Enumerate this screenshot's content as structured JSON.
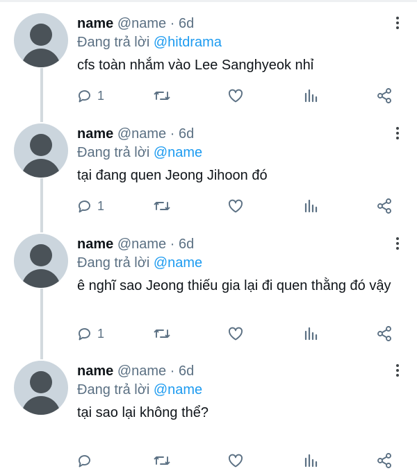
{
  "colors": {
    "link": "#1d9bf0",
    "secondary": "#5b7083",
    "text": "#0f1419",
    "avatar_bg": "#cbd5dd",
    "thread_line": "#d3dade"
  },
  "icons": [
    "more-vertical-icon",
    "reply-icon",
    "retweet-icon",
    "like-icon",
    "analytics-icon",
    "share-icon"
  ],
  "tweets": [
    {
      "name": "name",
      "handle": "@name",
      "dot": "·",
      "time": "6d",
      "replying_prefix": "Đang trả lời",
      "replying_to": "@hitdrama",
      "text": "cfs toàn nhắm vào Lee Sanghyeok nhỉ",
      "reply_count": "1"
    },
    {
      "name": "name",
      "handle": "@name",
      "dot": "·",
      "time": "6d",
      "replying_prefix": "Đang trả lời",
      "replying_to": "@name",
      "text": "tại đang quen Jeong Jihoon đó",
      "reply_count": "1"
    },
    {
      "name": "name",
      "handle": "@name",
      "dot": "·",
      "time": "6d",
      "replying_prefix": "Đang trả lời",
      "replying_to": "@name",
      "text": "ê nghĩ sao Jeong thiếu gia lại đi quen thằng đó vậy",
      "reply_count": "1"
    },
    {
      "name": "name",
      "handle": "@name",
      "dot": "·",
      "time": "6d",
      "replying_prefix": "Đang trả lời",
      "replying_to": "@name",
      "text": "tại sao lại không thể?",
      "reply_count": ""
    }
  ]
}
